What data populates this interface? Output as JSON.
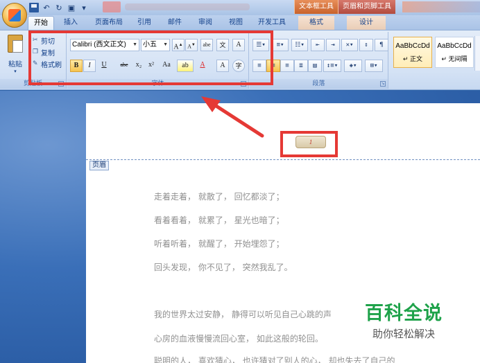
{
  "titlebar": {
    "qat_icons": [
      "save-icon",
      "undo-icon",
      "redo-icon",
      "print-preview-icon",
      "customize-icon"
    ],
    "context_tabs": [
      "文本框工具",
      "页眉和页脚工具"
    ],
    "colors": {
      "office_button": "#f6c25a",
      "context_tab": "#c8622b"
    }
  },
  "tabs": [
    "开始",
    "插入",
    "页面布局",
    "引用",
    "邮件",
    "审阅",
    "视图",
    "开发工具",
    "格式",
    "设计"
  ],
  "clipboard": {
    "paste_label": "粘贴",
    "cut_label": "剪切",
    "copy_label": "复制",
    "format_painter_label": "格式刷",
    "group_label": "剪贴板"
  },
  "font": {
    "font_name": "Calibri (西文正文)",
    "font_size": "小五",
    "buttons": [
      "A",
      "A",
      "abe",
      "A",
      "B",
      "I",
      "U",
      "abe",
      "x₂",
      "x²",
      "Aa",
      "ab",
      "A",
      "A",
      "字"
    ],
    "group_label": "字体"
  },
  "paragraph": {
    "group_label": "段落"
  },
  "styles": [
    {
      "sample": "AaBbCcDd",
      "name": "正文"
    },
    {
      "sample": "AaBbCcDd",
      "name": "无间隔"
    }
  ],
  "document": {
    "header_tag": "页眉",
    "page_number": "1",
    "lines": [
      "走着走着， 就散了， 回忆都淡了；",
      "看着看着， 就累了， 星光也暗了；",
      "听着听着， 就醒了， 开始埋怨了；",
      "回头发现， 你不见了， 突然我乱了。",
      "我的世界太过安静， 静得可以听见自己心跳的声",
      "心房的血液慢慢流回心室， 如此这般的轮回。",
      "聪明的人， 喜欢猜心， 也许猜对了别人的心， 却也失去了自己的"
    ]
  },
  "watermark": {
    "title": "百科全说",
    "subtitle": "助你轻松解决"
  },
  "annotation_color": "#e53935"
}
